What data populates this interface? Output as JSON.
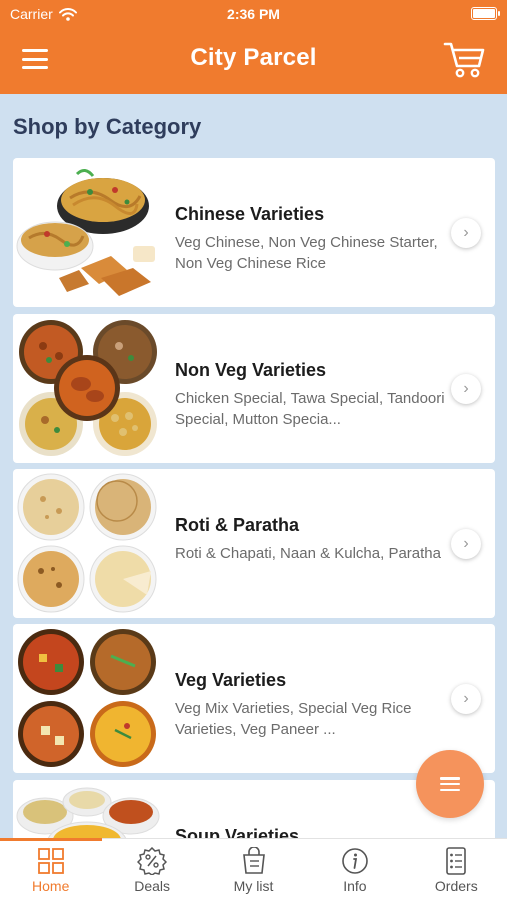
{
  "status": {
    "carrier": "Carrier",
    "time": "2:36 PM"
  },
  "header": {
    "title": "City Parcel"
  },
  "section_title": "Shop by Category",
  "categories": [
    {
      "name": "Chinese Varieties",
      "desc": "Veg Chinese, Non Veg Chinese Starter, Non Veg Chinese Rice"
    },
    {
      "name": "Non Veg Varieties",
      "desc": "Chicken Special, Tawa Special, Tandoori Special, Mutton Specia..."
    },
    {
      "name": "Roti & Paratha",
      "desc": "Roti & Chapati, Naan & Kulcha, Paratha"
    },
    {
      "name": "Veg Varieties",
      "desc": "Veg Mix Varieties, Special Veg Rice Varieties, Veg Paneer ..."
    },
    {
      "name": "Soup Varieties",
      "desc": ""
    }
  ],
  "tabs": [
    {
      "label": "Home",
      "icon": "grid-icon"
    },
    {
      "label": "Deals",
      "icon": "discount-icon"
    },
    {
      "label": "My list",
      "icon": "shopping-list-icon"
    },
    {
      "label": "Info",
      "icon": "info-icon"
    },
    {
      "label": "Orders",
      "icon": "orders-icon"
    }
  ],
  "colors": {
    "accent": "#f07b2e",
    "background": "#cfe0f0",
    "fab": "#f5935c",
    "title": "#2f3d5c"
  }
}
